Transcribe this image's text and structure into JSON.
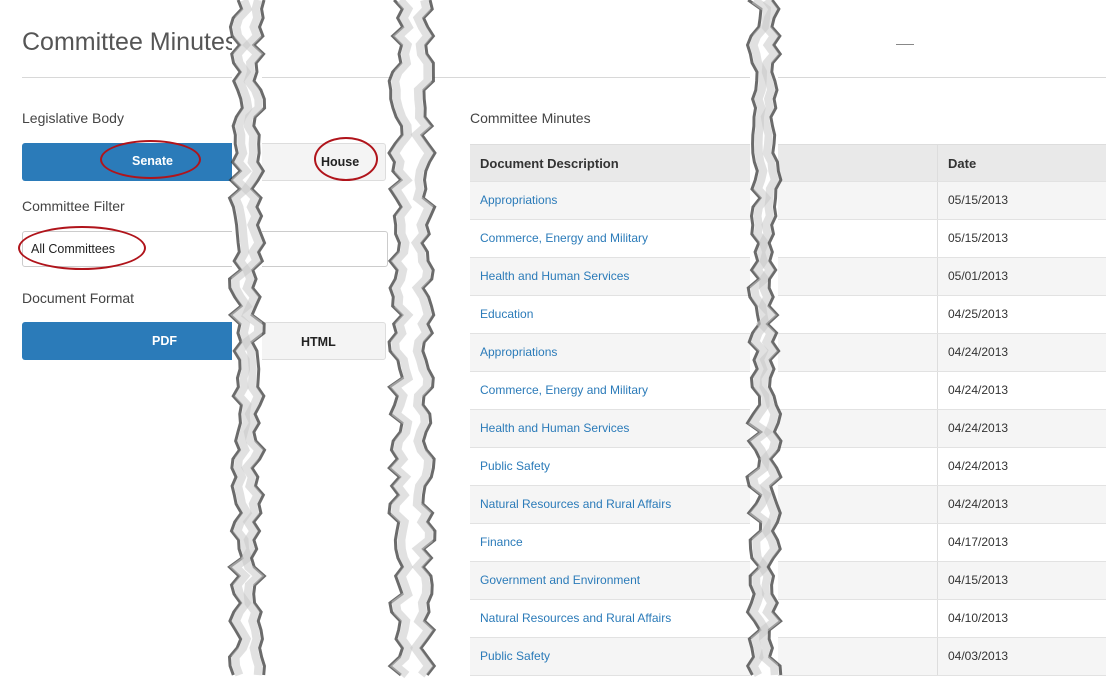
{
  "page": {
    "title": "Committee Minutes"
  },
  "legislative_body": {
    "label": "Legislative Body",
    "options": [
      "Senate",
      "House"
    ],
    "selected": "Senate"
  },
  "committee_filter": {
    "label": "Committee Filter",
    "value": "All Committees"
  },
  "document_format": {
    "label": "Document Format",
    "options": [
      "PDF",
      "HTML"
    ],
    "selected": "PDF"
  },
  "minutes": {
    "heading": "Committee Minutes",
    "columns": [
      "Document Description",
      "Date"
    ],
    "rows": [
      {
        "description": "Appropriations",
        "date": "05/15/2013"
      },
      {
        "description": "Commerce, Energy and Military",
        "date": "05/15/2013"
      },
      {
        "description": "Health and Human Services",
        "date": "05/01/2013"
      },
      {
        "description": "Education",
        "date": "04/25/2013"
      },
      {
        "description": "Appropriations",
        "date": "04/24/2013"
      },
      {
        "description": "Commerce, Energy and Military",
        "date": "04/24/2013"
      },
      {
        "description": "Health and Human Services",
        "date": "04/24/2013"
      },
      {
        "description": "Public Safety",
        "date": "04/24/2013"
      },
      {
        "description": "Natural Resources and Rural Affairs",
        "date": "04/24/2013"
      },
      {
        "description": "Finance",
        "date": "04/17/2013"
      },
      {
        "description": "Government and Environment",
        "date": "04/15/2013"
      },
      {
        "description": "Natural Resources and Rural Affairs",
        "date": "04/10/2013"
      },
      {
        "description": "Public Safety",
        "date": "04/03/2013"
      }
    ]
  },
  "colors": {
    "accent": "#2b7bb9",
    "annotation": "#b0141b",
    "link": "#2b7bb9"
  },
  "icons": [
    "minimize-icon"
  ]
}
